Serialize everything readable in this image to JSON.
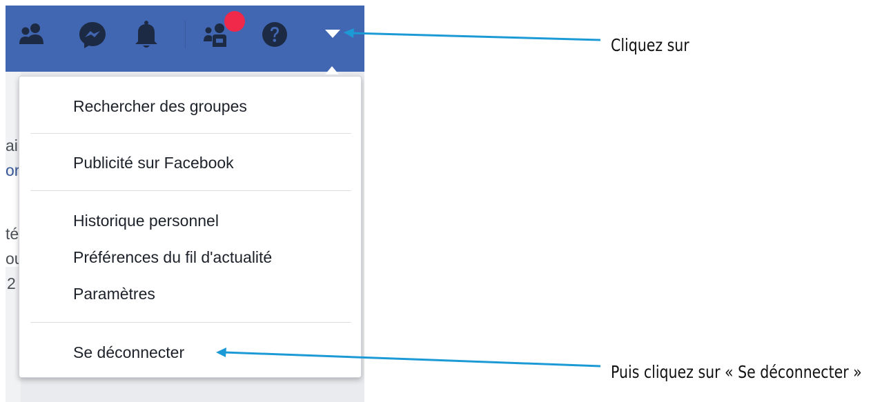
{
  "menu": {
    "items": [
      "Rechercher des groupes",
      "Publicité sur Facebook",
      "Historique personnel",
      "Préférences du fil d'actualité",
      "Paramètres",
      "Se déconnecter"
    ]
  },
  "background_fragments": [
    "ai",
    "or",
    "té",
    "ou",
    "2"
  ],
  "annotations": {
    "caret_hint": "Cliquez sur",
    "logout_hint": "Puis cliquez sur « Se déconnecter »"
  },
  "colors": {
    "toolbar": "#4267b2",
    "arrow": "#1c9ad6",
    "badge": "#f02849"
  },
  "icons": [
    "friends-icon",
    "messenger-icon",
    "bell-icon",
    "find-friends-icon",
    "help-icon",
    "account-menu-caret-icon"
  ]
}
